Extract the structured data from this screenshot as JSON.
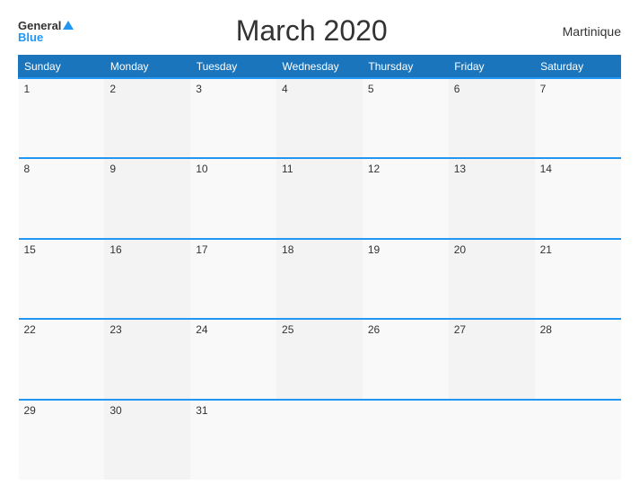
{
  "header": {
    "logo_general": "General",
    "logo_blue": "Blue",
    "title": "March 2020",
    "region": "Martinique"
  },
  "calendar": {
    "days_of_week": [
      "Sunday",
      "Monday",
      "Tuesday",
      "Wednesday",
      "Thursday",
      "Friday",
      "Saturday"
    ],
    "weeks": [
      [
        "1",
        "2",
        "3",
        "4",
        "5",
        "6",
        "7"
      ],
      [
        "8",
        "9",
        "10",
        "11",
        "12",
        "13",
        "14"
      ],
      [
        "15",
        "16",
        "17",
        "18",
        "19",
        "20",
        "21"
      ],
      [
        "22",
        "23",
        "24",
        "25",
        "26",
        "27",
        "28"
      ],
      [
        "29",
        "30",
        "31",
        "",
        "",
        "",
        ""
      ]
    ]
  }
}
